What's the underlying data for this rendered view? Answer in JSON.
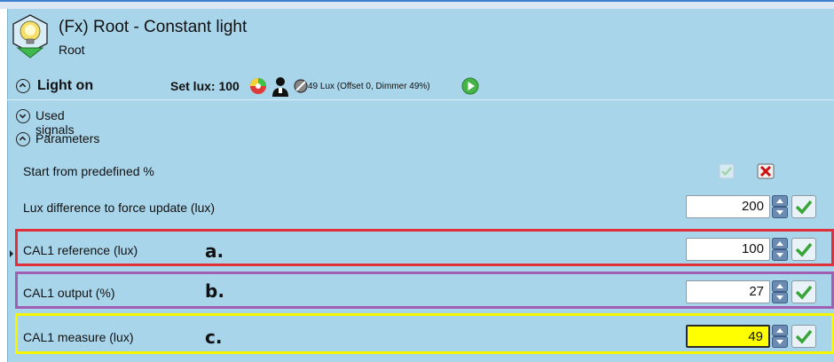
{
  "header": {
    "title": "(Fx) Root - Constant light",
    "subtitle": "Root"
  },
  "status": {
    "section_label": "Light on",
    "set_lux_label": "Set lux: 100",
    "lux_info": "49 Lux (Offset 0, Dimmer 49%)"
  },
  "sections": {
    "used_signals": "Used signals",
    "parameters": "Parameters"
  },
  "params": {
    "start_predefined": {
      "label": "Start from predefined %"
    },
    "lux_difference": {
      "label": "Lux difference to force update (lux)",
      "value": "200"
    },
    "cal1_reference": {
      "label": "CAL1 reference (lux)",
      "value": "100",
      "annotation": "a."
    },
    "cal1_output": {
      "label": "CAL1 output (%)",
      "value": "27",
      "annotation": "b."
    },
    "cal1_measure": {
      "label": "CAL1 measure (lux)",
      "value": "49",
      "annotation": "c."
    }
  },
  "colors": {
    "panel_bg": "#a9d5ea",
    "highlight_a": "#e0303a",
    "highlight_b": "#a05fb2",
    "highlight_c": "#f5f500",
    "measure_field_bg": "#ffff00",
    "confirm_check": "#3aa53a",
    "cancel_cross": "#cc1111"
  },
  "icons": {
    "logo": "bulb-hexagon-icon",
    "expand": "chevron-down-circle-icon",
    "collapse": "chevron-up-circle-icon",
    "play": "play-green-icon",
    "person": "person-icon",
    "disabled": "disabled-circle-icon",
    "wheel": "color-wheel-icon"
  }
}
